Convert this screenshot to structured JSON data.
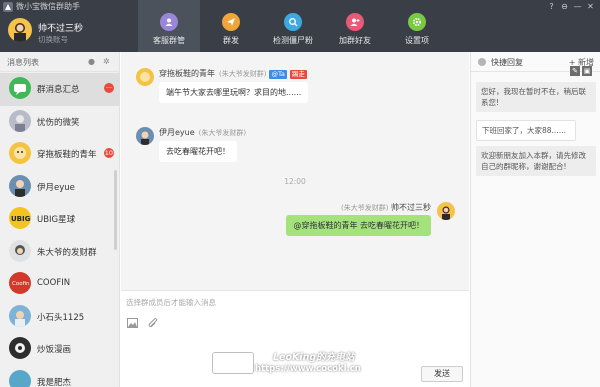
{
  "app": {
    "title": "微小宝微信群助手"
  },
  "window_controls": [
    "?",
    "⊖",
    "—",
    "✕"
  ],
  "profile": {
    "name": "帅不过三秒",
    "switch_label": "切换账号"
  },
  "nav_tabs": [
    {
      "label": "客服群管",
      "icon": "people-icon",
      "color": "#9a86d8"
    },
    {
      "label": "群发",
      "icon": "send-icon",
      "color": "#f0a53a"
    },
    {
      "label": "检测僵尸粉",
      "icon": "detect-icon",
      "color": "#3ea9e0"
    },
    {
      "label": "加群好友",
      "icon": "add-friend-icon",
      "color": "#e85a76"
    },
    {
      "label": "设置项",
      "icon": "gear-icon",
      "color": "#7ac943"
    }
  ],
  "sidebar": {
    "title": "消息列表",
    "items": [
      {
        "name": "群消息汇总",
        "badge": "···",
        "avatar_color": "#3fb858"
      },
      {
        "name": "忧伤的微笑",
        "badge": "",
        "avatar_color": "#b9bcc8"
      },
      {
        "name": "穿拖板鞋的青年",
        "badge": "10",
        "avatar_color": "#f3c441"
      },
      {
        "name": "伊月eyue",
        "badge": "",
        "avatar_color": "#6a8fb0"
      },
      {
        "name": "UBIG星球",
        "badge": "",
        "avatar_color": "#f3c41b"
      },
      {
        "name": "朱大爷的发财群",
        "badge": "",
        "avatar_color": "#9aa0a4"
      },
      {
        "name": "COOFIN",
        "badge": "",
        "avatar_color": "#d2392b"
      },
      {
        "name": "小石头1125",
        "badge": "",
        "avatar_color": "#7db3d9"
      },
      {
        "name": "炒饭漫画",
        "badge": "",
        "avatar_color": "#2e2e2e"
      },
      {
        "name": "我是肥杰",
        "badge": "",
        "avatar_color": "#58a7c9"
      }
    ]
  },
  "chat": {
    "messages": [
      {
        "sender": "穿拖板鞋的青年",
        "group": "(朱大爷发财群)",
        "tags": [
          "@Ta",
          "踢走"
        ],
        "text": "端午节大家去哪里玩啊？求目的地......"
      },
      {
        "sender": "伊月eyue",
        "group": "(朱大爷发财群)",
        "tags": [],
        "text": "去吃春曜花开吧！"
      }
    ],
    "timestamp": "12:00",
    "my_message": {
      "sender": "帅不过三秒",
      "group": "(朱大爷发财群)",
      "text": "@穿拖板鞋的青年 去吃春曜花开吧！"
    },
    "tag_colors": {
      "at": "#3a8ee6",
      "kick": "#e84b3c"
    }
  },
  "composer": {
    "placeholder": "选择群成员后才能输入消息",
    "send_label": "发送"
  },
  "quick_reply": {
    "title": "快捷回复",
    "add_label": "+ 新增",
    "items": [
      "您好，我现在暂时不在，稍后联系您!",
      "下班回家了，大家88......",
      "欢迎新朋友加入本群，请先修改自己的群昵称，谢谢配合!"
    ]
  },
  "watermark": {
    "line1": "LeoKing的充电站",
    "line2": "https://www.cocokl.cn"
  }
}
